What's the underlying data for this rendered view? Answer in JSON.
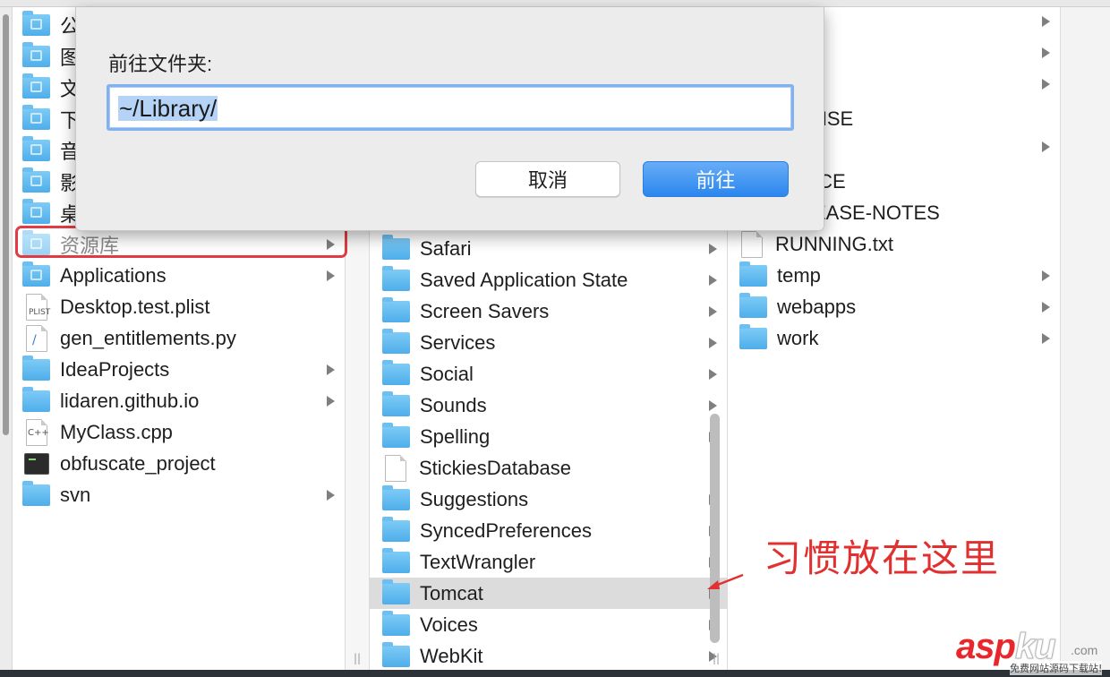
{
  "dialog": {
    "title": "前往文件夹:",
    "path_value": "~/Library/",
    "cancel_label": "取消",
    "go_label": "前往"
  },
  "column1": {
    "partial_items": [
      {
        "label": "公",
        "icon": "sidebar-folder-icon"
      },
      {
        "label": "图",
        "icon": "pictures-folder-icon"
      },
      {
        "label": "文",
        "icon": "documents-folder-icon"
      },
      {
        "label": "下",
        "icon": "downloads-folder-icon"
      },
      {
        "label": "音",
        "icon": "music-folder-icon"
      },
      {
        "label": "影",
        "icon": "movies-folder-icon"
      },
      {
        "label": "桌",
        "icon": "desktop-folder-icon"
      }
    ],
    "items": [
      {
        "label": "资源库",
        "icon": "library-folder-icon",
        "arrow": true
      },
      {
        "label": "Applications",
        "icon": "applications-folder-icon",
        "arrow": true
      },
      {
        "label": "Desktop.test.plist",
        "icon": "plist-file-icon",
        "arrow": false
      },
      {
        "label": "gen_entitlements.py",
        "icon": "python-file-icon",
        "arrow": false
      },
      {
        "label": "IdeaProjects",
        "icon": "folder-icon",
        "arrow": true
      },
      {
        "label": "lidaren.github.io",
        "icon": "folder-icon",
        "arrow": true
      },
      {
        "label": "MyClass.cpp",
        "icon": "cpp-file-icon",
        "arrow": false
      },
      {
        "label": "obfuscate_project",
        "icon": "terminal-executable-icon",
        "arrow": false
      },
      {
        "label": "svn",
        "icon": "folder-icon",
        "arrow": true
      }
    ]
  },
  "column2": {
    "items": [
      {
        "label": "Safari",
        "icon": "folder-icon",
        "arrow": true
      },
      {
        "label": "Saved Application State",
        "icon": "folder-icon",
        "arrow": true
      },
      {
        "label": "Screen Savers",
        "icon": "folder-icon",
        "arrow": true
      },
      {
        "label": "Services",
        "icon": "folder-icon",
        "arrow": true
      },
      {
        "label": "Social",
        "icon": "folder-icon",
        "arrow": true
      },
      {
        "label": "Sounds",
        "icon": "folder-icon",
        "arrow": true
      },
      {
        "label": "Spelling",
        "icon": "folder-icon",
        "arrow": true
      },
      {
        "label": "StickiesDatabase",
        "icon": "document-file-icon",
        "arrow": false
      },
      {
        "label": "Suggestions",
        "icon": "folder-icon",
        "arrow": true
      },
      {
        "label": "SyncedPreferences",
        "icon": "folder-icon",
        "arrow": true
      },
      {
        "label": "TextWrangler",
        "icon": "folder-icon",
        "arrow": true
      },
      {
        "label": "Tomcat",
        "icon": "folder-icon",
        "arrow": true,
        "selected": true
      },
      {
        "label": "Voices",
        "icon": "folder-icon",
        "arrow": true
      },
      {
        "label": "WebKit",
        "icon": "folder-icon",
        "arrow": true
      }
    ]
  },
  "column3": {
    "partial_items": [
      {
        "label": "NSE"
      },
      {
        "label": "ICE"
      },
      {
        "label": "EASE-NOTES"
      }
    ],
    "items": [
      {
        "label": "RUNNING.txt",
        "icon": "text-file-icon",
        "arrow": false
      },
      {
        "label": "temp",
        "icon": "folder-icon",
        "arrow": true
      },
      {
        "label": "webapps",
        "icon": "folder-icon",
        "arrow": true
      },
      {
        "label": "work",
        "icon": "folder-icon",
        "arrow": true
      }
    ]
  },
  "annotation": {
    "note": "习惯放在这里",
    "color": "#e0302f"
  },
  "watermark": {
    "brand_a": "asp",
    "brand_b": "ku",
    "domain": ".com",
    "subtitle": "免费网站源码下载站!"
  },
  "colors": {
    "folder_blue": "#5bb7ee",
    "go_button_blue": "#2b86ee",
    "highlight_red": "#e23b44",
    "selection_gray": "#dcdcdc"
  }
}
